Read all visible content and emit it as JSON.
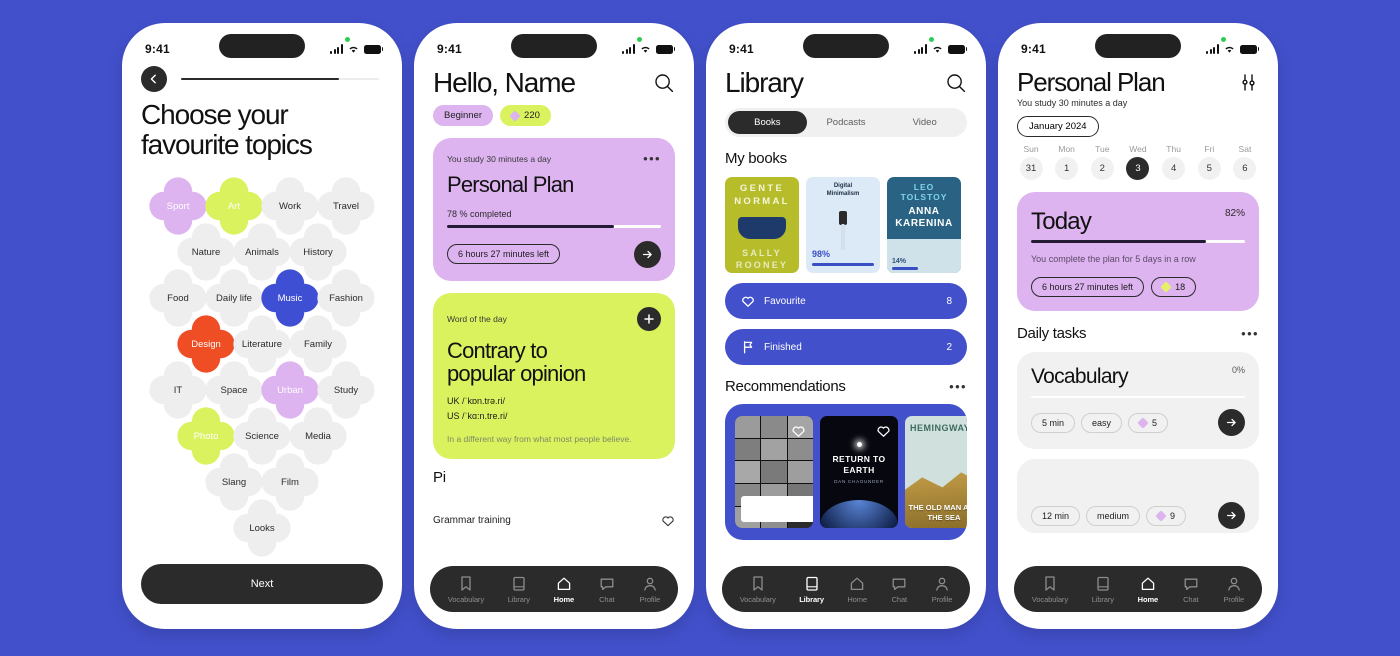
{
  "theme": {
    "background": "#4250cb",
    "accent_blue": "#4250cb",
    "dark": "#2b2b2b",
    "lilac": "#d7b3f0",
    "lime": "#d9f25e",
    "orange": "#ef4d23",
    "violet": "#3f4fd4"
  },
  "status_bar": {
    "time": "9:41"
  },
  "screen1": {
    "title_line1": "Choose your",
    "title_line2": "favourite topics",
    "next_label": "Next",
    "rows": [
      [
        {
          "label": "Sport",
          "color": "#ddb3f0",
          "selected": true
        },
        {
          "label": "Art",
          "color": "#d9f25e",
          "selected": true
        },
        {
          "label": "Work",
          "color": "#eeeeee",
          "selected": false
        },
        {
          "label": "Travel",
          "color": "#eeeeee",
          "selected": false
        }
      ],
      [
        {
          "label": "Nature",
          "color": "#eeeeee",
          "selected": false
        },
        {
          "label": "Animals",
          "color": "#eeeeee",
          "selected": false
        },
        {
          "label": "History",
          "color": "#eeeeee",
          "selected": false
        }
      ],
      [
        {
          "label": "Food",
          "color": "#eeeeee",
          "selected": false
        },
        {
          "label": "Daily life",
          "color": "#eeeeee",
          "selected": false
        },
        {
          "label": "Music",
          "color": "#3f4fd4",
          "selected": true
        },
        {
          "label": "Fashion",
          "color": "#eeeeee",
          "selected": false
        }
      ],
      [
        {
          "label": "Design",
          "color": "#ef4d23",
          "selected": true
        },
        {
          "label": "Literature",
          "color": "#eeeeee",
          "selected": false
        },
        {
          "label": "Family",
          "color": "#eeeeee",
          "selected": false
        }
      ],
      [
        {
          "label": "IT",
          "color": "#eeeeee",
          "selected": false
        },
        {
          "label": "Space",
          "color": "#eeeeee",
          "selected": false
        },
        {
          "label": "Urban",
          "color": "#ddb3f0",
          "selected": true
        },
        {
          "label": "Study",
          "color": "#eeeeee",
          "selected": false
        }
      ],
      [
        {
          "label": "Photo",
          "color": "#d9f25e",
          "selected": true
        },
        {
          "label": "Science",
          "color": "#eeeeee",
          "selected": false
        },
        {
          "label": "Media",
          "color": "#eeeeee",
          "selected": false
        }
      ],
      [
        {
          "label": "Slang",
          "color": "#eeeeee",
          "selected": false
        },
        {
          "label": "Film",
          "color": "#eeeeee",
          "selected": false
        }
      ],
      [
        {
          "label": "Looks",
          "color": "#eeeeee",
          "selected": false
        }
      ]
    ]
  },
  "screen2": {
    "greeting": "Hello, Name",
    "level_chip": "Beginner",
    "points_chip": "220",
    "plan_card": {
      "kicker": "You study 30 minutes a day",
      "title": "Personal Plan",
      "progress_label": "78 % completed",
      "progress_pct": 78,
      "time_left": "6 hours 27 minutes left",
      "more_icon": "ellipsis-icon",
      "go_icon": "arrow-right-icon"
    },
    "word_card": {
      "kicker": "Word of the day",
      "word_line1": "Contrary to",
      "word_line2": "popular opinion",
      "uk": "UK /ˈkɒn.trə.ri/",
      "us": "US /ˈkɑ:n.tre.ri/",
      "definition": "In a different way from what most people believe.",
      "add_icon": "plus-icon"
    },
    "peek_section_title": "Pi",
    "peek_item": "Grammar training",
    "tabs": [
      {
        "label": "Vocabulary",
        "icon": "bookmark-icon",
        "active": false
      },
      {
        "label": "Library",
        "icon": "book-icon",
        "active": false
      },
      {
        "label": "Home",
        "icon": "home-icon",
        "active": true
      },
      {
        "label": "Chat",
        "icon": "chat-icon",
        "active": false
      },
      {
        "label": "Profile",
        "icon": "person-icon",
        "active": false
      }
    ]
  },
  "screen3": {
    "title": "Library",
    "segments": [
      {
        "label": "Books",
        "active": true
      },
      {
        "label": "Podcasts",
        "active": false
      },
      {
        "label": "Video",
        "active": false
      }
    ],
    "my_books_title": "My books",
    "books": [
      {
        "title": "GENTE NORMAL",
        "author": "SALLY ROONEY",
        "bg": "#b7bd2a",
        "progress": ""
      },
      {
        "title": "Digital Minimalism",
        "author": "",
        "bg": "#dbeaf6",
        "progress": "98%"
      },
      {
        "title": "ANNA KARENINA",
        "author": "LEO TOLSTOY",
        "bg": "#2a6283",
        "progress": "14%"
      },
      {
        "title": "",
        "author": "",
        "bg": "#f7b6b6",
        "progress": ""
      }
    ],
    "rows": [
      {
        "label": "Favourite",
        "count": "8",
        "icon": "heart-icon"
      },
      {
        "label": "Finished",
        "count": "2",
        "icon": "flag-icon"
      }
    ],
    "recommendations_title": "Recommendations",
    "recommendations_more": "ellipsis-icon",
    "recommendations": [
      {
        "title": "",
        "bg": "#f2f2f2",
        "kind": "eye-grid"
      },
      {
        "title": "RETURN TO EARTH",
        "subtitle": "DAN CHAOUNDER",
        "bg": "#07080f",
        "kind": "space"
      },
      {
        "title": "THE OLD MAN AND THE SEA",
        "author": "HEMINGWAY",
        "bg": "#cfe0dd",
        "kind": "hemingway"
      }
    ],
    "tabs": [
      {
        "label": "Vocabulary",
        "icon": "bookmark-icon",
        "active": false
      },
      {
        "label": "Library",
        "icon": "book-icon",
        "active": true
      },
      {
        "label": "Home",
        "icon": "home-icon",
        "active": false
      },
      {
        "label": "Chat",
        "icon": "chat-icon",
        "active": false
      },
      {
        "label": "Profile",
        "icon": "person-icon",
        "active": false
      }
    ]
  },
  "screen4": {
    "title": "Personal Plan",
    "subtitle": "You study 30 minutes a day",
    "settings_icon": "sliders-icon",
    "month": "January 2024",
    "days": [
      {
        "name": "Sun",
        "num": "31",
        "selected": false
      },
      {
        "name": "Mon",
        "num": "1",
        "selected": false
      },
      {
        "name": "Tue",
        "num": "2",
        "selected": false
      },
      {
        "name": "Wed",
        "num": "3",
        "selected": true
      },
      {
        "name": "Thu",
        "num": "4",
        "selected": false
      },
      {
        "name": "Fri",
        "num": "5",
        "selected": false
      },
      {
        "name": "Sat",
        "num": "6",
        "selected": false
      }
    ],
    "today_card": {
      "title": "Today",
      "pct_label": "82%",
      "progress_pct": 82,
      "streak_text": "You complete the plan for 5 days in a row",
      "time_left": "6 hours 27 minutes left",
      "gems": "18"
    },
    "daily_tasks_title": "Daily tasks",
    "daily_tasks_more": "ellipsis-icon",
    "tasks": [
      {
        "name": "Vocabulary",
        "pct": "0%",
        "progress_pct": 0,
        "duration": "5 min",
        "difficulty": "easy",
        "gems": "5"
      },
      {
        "name": "",
        "pct": "",
        "progress_pct": 0,
        "duration": "12 min",
        "difficulty": "medium",
        "gems": "9"
      }
    ],
    "tabs": [
      {
        "label": "Vocabulary",
        "icon": "bookmark-icon",
        "active": false
      },
      {
        "label": "Library",
        "icon": "book-icon",
        "active": false
      },
      {
        "label": "Home",
        "icon": "home-icon",
        "active": true
      },
      {
        "label": "Chat",
        "icon": "chat-icon",
        "active": false
      },
      {
        "label": "Profile",
        "icon": "person-icon",
        "active": false
      }
    ]
  }
}
